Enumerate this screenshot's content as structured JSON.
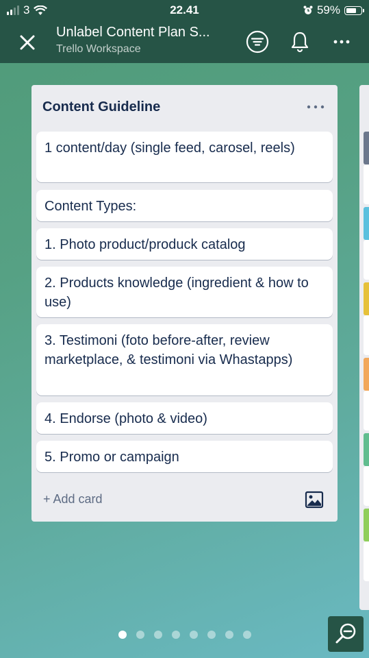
{
  "status_bar": {
    "carrier": "3",
    "time": "22.41",
    "battery": "59%"
  },
  "header": {
    "board_title": "Unlabel Content Plan S...",
    "workspace": "Trello Workspace",
    "icons": [
      "close-icon",
      "filter-icon",
      "bell-icon",
      "more-icon"
    ]
  },
  "list": {
    "title": "Content Guideline",
    "cards": [
      "1 content/day (single feed, carosel, reels)",
      "Content Types:",
      "1. Photo product/produck catalog",
      "2. Products knowledge (ingredient & how to use)",
      "3. Testimoni (foto before-after, review marketplace, & testimoni via Whastapps)",
      "4. Endorse (photo & video)",
      "5. Promo or campaign"
    ],
    "add_card": "+ Add card"
  },
  "next_list": {
    "label_colors": [
      "#6b778c",
      "#5bc0de",
      "#e6c13a",
      "#f2a75a",
      "#61bd8f",
      "#8fce5a"
    ]
  },
  "pagination": {
    "total": 8,
    "active": 1
  },
  "colors": {
    "header": "#265446",
    "list_bg": "#ebecf0",
    "card_text": "#172b4d"
  }
}
